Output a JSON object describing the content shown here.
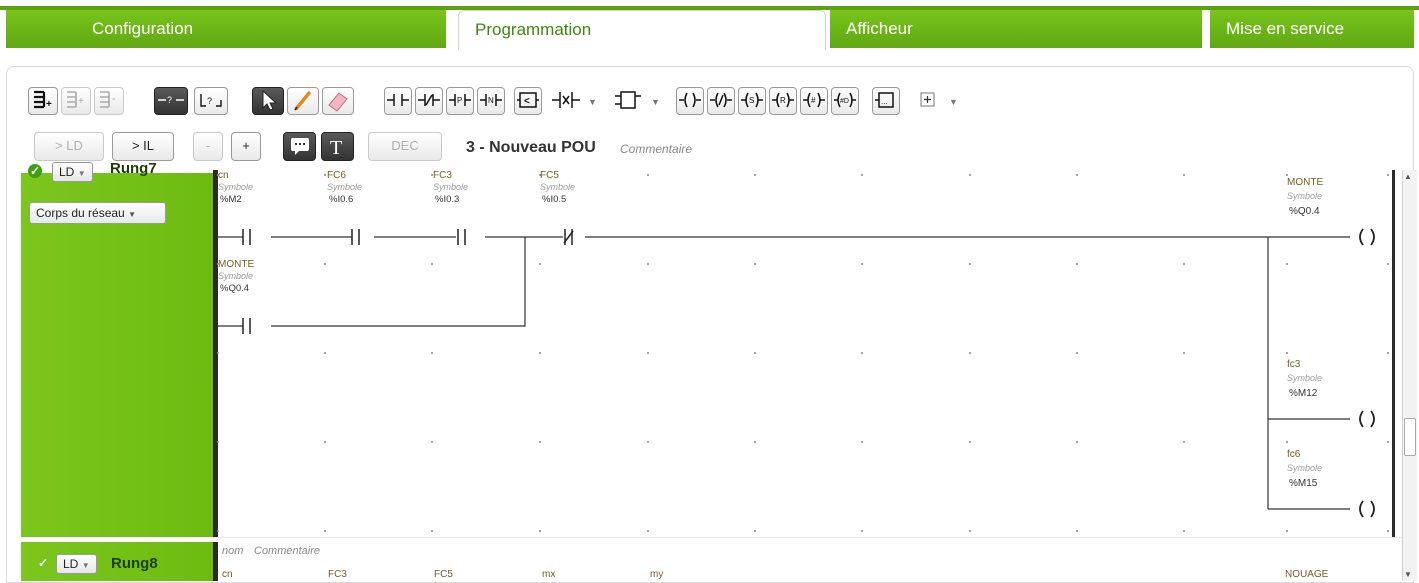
{
  "tabs": [
    {
      "label": "Configuration"
    },
    {
      "label": "Programmation"
    },
    {
      "label": "Afficheur"
    },
    {
      "label": "Mise en service"
    }
  ],
  "toolbar": {
    "ld_label": "> LD",
    "il_label": "> IL",
    "minus_label": "-",
    "plus_label": "+",
    "dec_label": "DEC",
    "icons": [
      "add-rung-icon",
      "insert-rung-icon",
      "delete-rung-icon",
      "unknown-element-icon",
      "branch-icon",
      "select-pointer-icon",
      "pencil-icon",
      "eraser-icon",
      "contact-no-icon",
      "contact-nc-icon",
      "contact-p-icon",
      "contact-n-icon",
      "compare-block-icon",
      "contact-menu-icon",
      "function-block-icon",
      "coil-icon",
      "coil-negated-icon",
      "coil-set-icon",
      "coil-reset-icon",
      "coil-jump-icon",
      "coil-call-icon",
      "operation-block-icon",
      "add-element-icon",
      "comment-icon",
      "text-icon"
    ]
  },
  "pou": {
    "title": "3 - Nouveau POU",
    "comment": "Commentaire"
  },
  "rung7": {
    "lang": "LD",
    "name": "Rung7",
    "body_dropdown": "Corps du réseau",
    "contacts": [
      {
        "name": "cn",
        "symbol": "Symbole",
        "addr": "%M2",
        "type": "NO"
      },
      {
        "name": "FC6",
        "symbol": "Symbole",
        "addr": "%I0.6",
        "type": "NO"
      },
      {
        "name": "FC3",
        "symbol": "Symbole",
        "addr": "%I0.3",
        "type": "NO"
      },
      {
        "name": "FC5",
        "symbol": "Symbole",
        "addr": "%I0.5",
        "type": "NC"
      },
      {
        "name": "MONTE",
        "symbol": "Symbole",
        "addr": "%Q0.4",
        "type": "NO"
      }
    ],
    "coils": [
      {
        "name": "MONTE",
        "symbol": "Symbole",
        "addr": "%Q0.4"
      },
      {
        "name": "fc3",
        "symbol": "Symbole",
        "addr": "%M12"
      },
      {
        "name": "fc6",
        "symbol": "Symbole",
        "addr": "%M15"
      }
    ]
  },
  "rung8": {
    "lang": "LD",
    "name": "Rung8",
    "comment_name": "nom",
    "comment": "Commentaire",
    "labels": [
      "cn",
      "FC3",
      "FC5",
      "mx",
      "my",
      "NOUAGE"
    ]
  },
  "colors": {
    "tab_green": "#6cb617",
    "rung_green": "#74c118",
    "accent_text": "#3c8a0b"
  }
}
